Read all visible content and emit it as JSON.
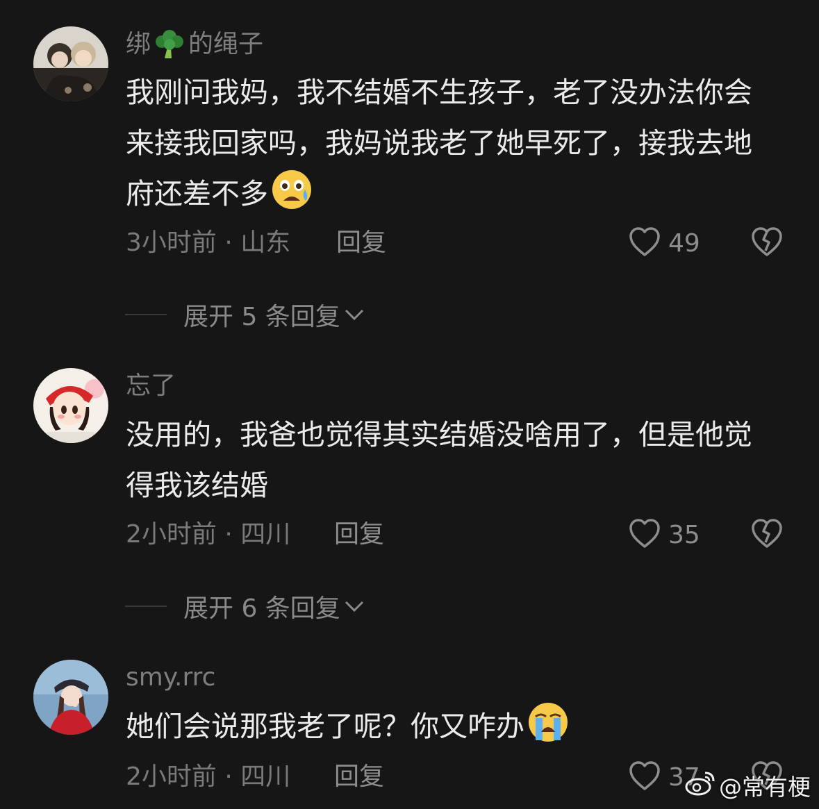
{
  "comments": [
    {
      "username_prefix": "绑",
      "username_emoji": "broccoli",
      "username_suffix": "的绳子",
      "text": "我刚问我妈，我不结婚不生孩子，老了没办法你会来接我回家吗，我妈说我老了她早死了，接我去地府还差不多",
      "trailing_emoji": "anxious-sweat-face",
      "meta": "3小时前 · 山东",
      "reply_label": "回复",
      "likes": "49",
      "expand_label": "展开 5 条回复"
    },
    {
      "username": "忘了",
      "text": "没用的，我爸也觉得其实结婚没啥用了，但是他觉得我该结婚",
      "meta": "2小时前 · 四川",
      "reply_label": "回复",
      "likes": "35",
      "expand_label": "展开 6 条回复"
    },
    {
      "username": "smy.rrc",
      "text": "她们会说那我老了呢？你又咋办",
      "trailing_emoji": "loudly-crying-face",
      "meta": "2小时前 · 四川",
      "reply_label": "回复",
      "likes": "37"
    }
  ],
  "watermark": {
    "icon": "weibo-icon",
    "text": "@常有梗"
  },
  "icons": {
    "like": "heart-outline-icon",
    "dislike": "broken-heart-icon",
    "expand": "chevron-down-icon"
  },
  "colors": {
    "background": "#161616",
    "text": "#ebebeb",
    "secondary": "#7a7a7a"
  }
}
